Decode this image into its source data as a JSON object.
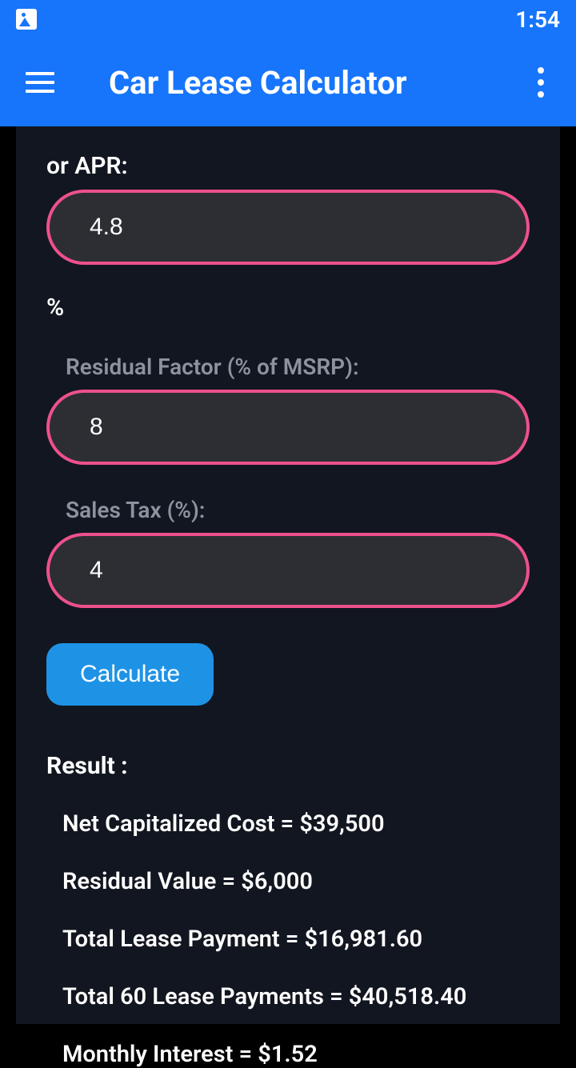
{
  "statusBar": {
    "time": "1:54"
  },
  "appBar": {
    "title": "Car Lease Calculator"
  },
  "form": {
    "aprLabel": "or APR:",
    "aprValue": "4.8",
    "percentSymbol": "%",
    "residualFactorLabel": "Residual Factor (% of MSRP):",
    "residualFactorValue": "8",
    "salesTaxLabel": "Sales Tax (%):",
    "salesTaxValue": "4",
    "calculateLabel": "Calculate"
  },
  "results": {
    "heading": "Result :",
    "lines": [
      "Net Capitalized Cost = $39,500",
      "Residual Value = $6,000",
      "Total Lease Payment = $16,981.60",
      "Total 60 Lease Payments = $40,518.40",
      "Monthly Interest = $1.52"
    ]
  }
}
